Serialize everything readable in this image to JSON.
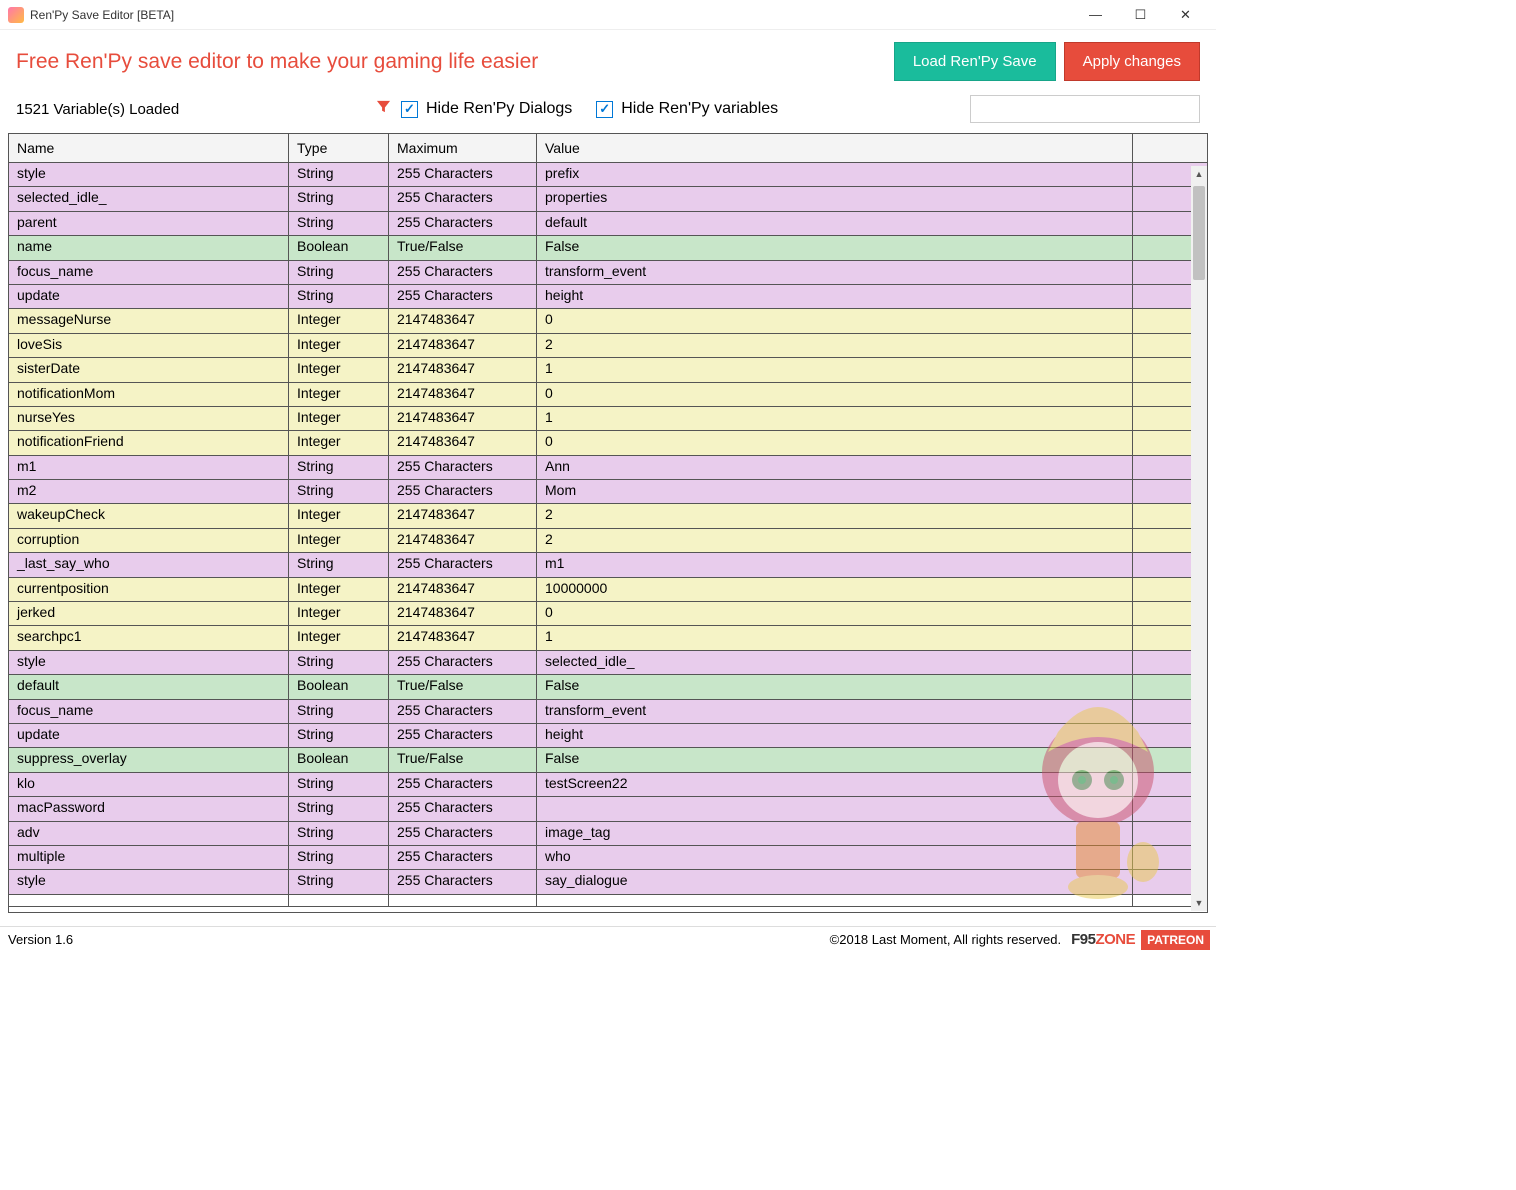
{
  "window": {
    "title": "Ren'Py Save Editor [BETA]"
  },
  "header": {
    "tagline": "Free Ren'Py save editor to make your gaming life easier",
    "load_button": "Load Ren'Py Save",
    "apply_button": "Apply changes"
  },
  "filters": {
    "variable_count": "1521 Variable(s) Loaded",
    "hide_dialogs_label": "Hide Ren'Py Dialogs",
    "hide_variables_label": "Hide Ren'Py variables",
    "search_placeholder": ""
  },
  "grid": {
    "columns": {
      "name": "Name",
      "type": "Type",
      "max": "Maximum",
      "value": "Value"
    },
    "rows": [
      {
        "name": "style",
        "type": "String",
        "max": "255 Characters",
        "value": "prefix"
      },
      {
        "name": "selected_idle_",
        "type": "String",
        "max": "255 Characters",
        "value": "properties"
      },
      {
        "name": "parent",
        "type": "String",
        "max": "255 Characters",
        "value": "default"
      },
      {
        "name": "name",
        "type": "Boolean",
        "max": "True/False",
        "value": "False"
      },
      {
        "name": "focus_name",
        "type": "String",
        "max": "255 Characters",
        "value": "transform_event"
      },
      {
        "name": "update",
        "type": "String",
        "max": "255 Characters",
        "value": "height"
      },
      {
        "name": "messageNurse",
        "type": "Integer",
        "max": "2147483647",
        "value": "0"
      },
      {
        "name": "loveSis",
        "type": "Integer",
        "max": "2147483647",
        "value": "2"
      },
      {
        "name": "sisterDate",
        "type": "Integer",
        "max": "2147483647",
        "value": "1"
      },
      {
        "name": "notificationMom",
        "type": "Integer",
        "max": "2147483647",
        "value": "0"
      },
      {
        "name": "nurseYes",
        "type": "Integer",
        "max": "2147483647",
        "value": "1"
      },
      {
        "name": "notificationFriend",
        "type": "Integer",
        "max": "2147483647",
        "value": "0"
      },
      {
        "name": "m1",
        "type": "String",
        "max": "255 Characters",
        "value": "Ann"
      },
      {
        "name": "m2",
        "type": "String",
        "max": "255 Characters",
        "value": "Mom"
      },
      {
        "name": "wakeupCheck",
        "type": "Integer",
        "max": "2147483647",
        "value": "2"
      },
      {
        "name": "corruption",
        "type": "Integer",
        "max": "2147483647",
        "value": "2"
      },
      {
        "name": "_last_say_who",
        "type": "String",
        "max": "255 Characters",
        "value": "m1"
      },
      {
        "name": "currentposition",
        "type": "Integer",
        "max": "2147483647",
        "value": "10000000"
      },
      {
        "name": "jerked",
        "type": "Integer",
        "max": "2147483647",
        "value": "0"
      },
      {
        "name": "searchpc1",
        "type": "Integer",
        "max": "2147483647",
        "value": "1"
      },
      {
        "name": "style",
        "type": "String",
        "max": "255 Characters",
        "value": "selected_idle_"
      },
      {
        "name": "default",
        "type": "Boolean",
        "max": "True/False",
        "value": "False"
      },
      {
        "name": "focus_name",
        "type": "String",
        "max": "255 Characters",
        "value": "transform_event"
      },
      {
        "name": "update",
        "type": "String",
        "max": "255 Characters",
        "value": "height"
      },
      {
        "name": "suppress_overlay",
        "type": "Boolean",
        "max": "True/False",
        "value": "False"
      },
      {
        "name": "klo",
        "type": "String",
        "max": "255 Characters",
        "value": "testScreen22"
      },
      {
        "name": "macPassword",
        "type": "String",
        "max": "255 Characters",
        "value": ""
      },
      {
        "name": "adv",
        "type": "String",
        "max": "255 Characters",
        "value": "image_tag"
      },
      {
        "name": "multiple",
        "type": "String",
        "max": "255 Characters",
        "value": "who"
      },
      {
        "name": "style",
        "type": "String",
        "max": "255 Characters",
        "value": "say_dialogue"
      }
    ]
  },
  "footer": {
    "version": "Version 1.6",
    "copyright": "©2018 Last Moment, All rights reserved.",
    "f95_a": "F95",
    "f95_b": "ZONE",
    "patreon": "PATREON"
  }
}
